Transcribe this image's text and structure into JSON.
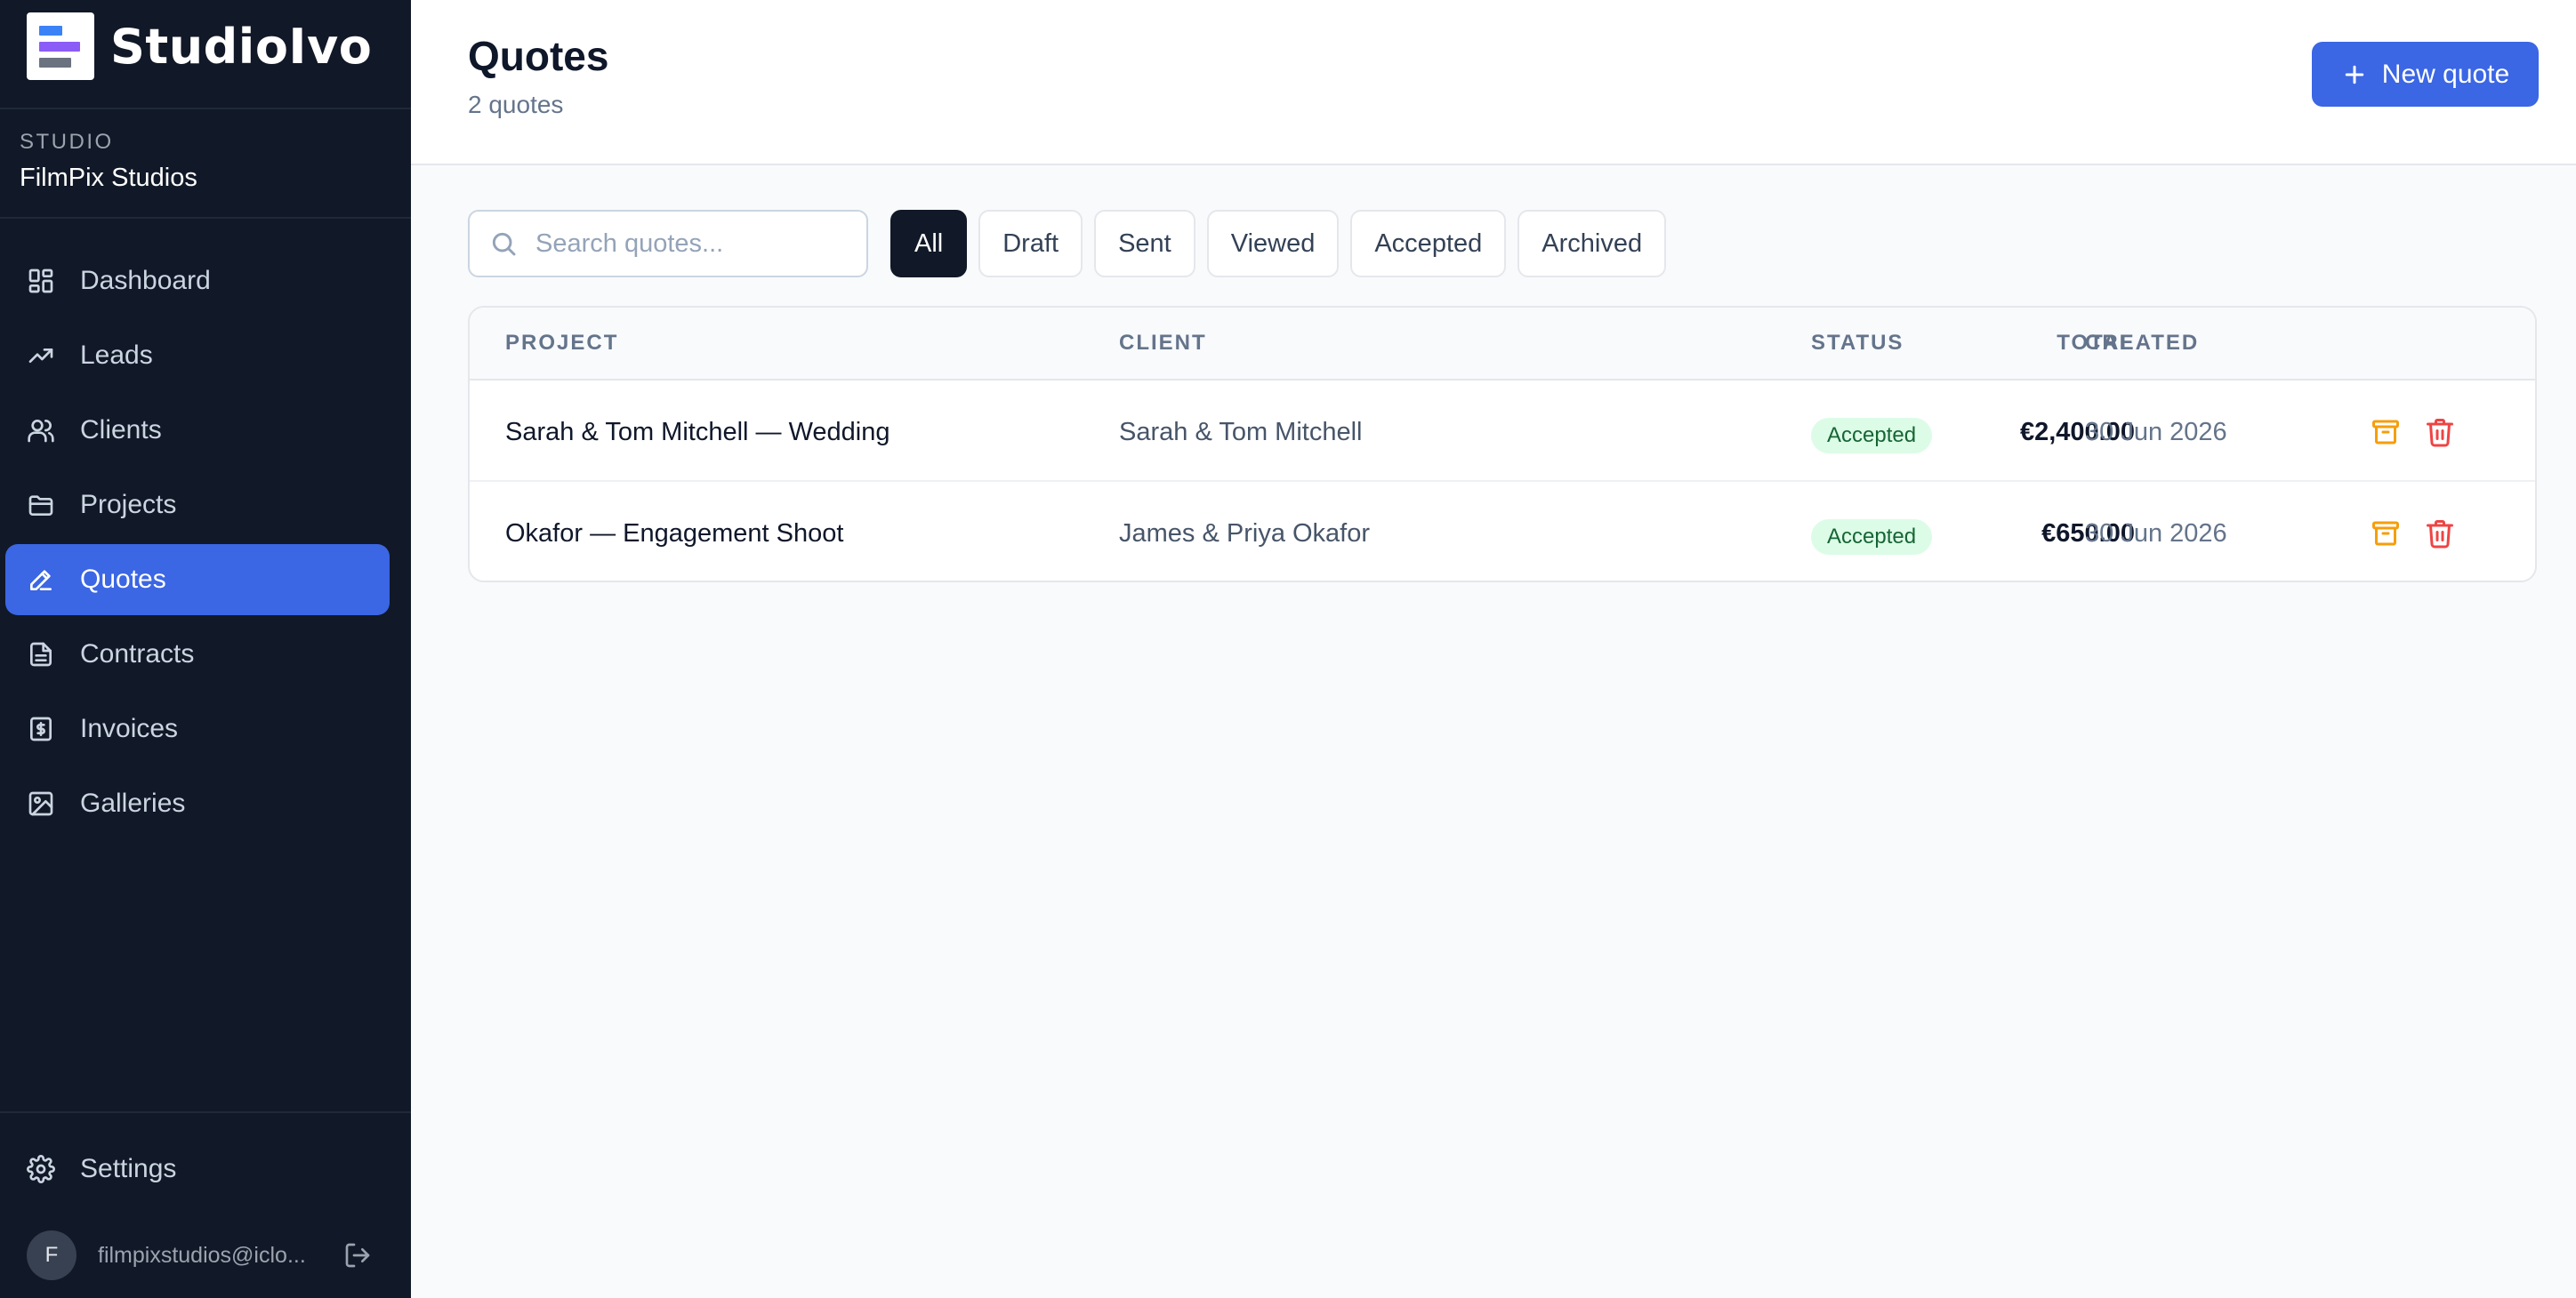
{
  "brand": {
    "name": "StudioIvo"
  },
  "studio": {
    "label": "STUDIO",
    "name": "FilmPix Studios"
  },
  "nav": {
    "items": [
      {
        "label": "Dashboard",
        "icon": "dashboard-icon"
      },
      {
        "label": "Leads",
        "icon": "trending-up-icon"
      },
      {
        "label": "Clients",
        "icon": "users-icon"
      },
      {
        "label": "Projects",
        "icon": "folder-icon"
      },
      {
        "label": "Quotes",
        "icon": "pencil-icon",
        "active": true
      },
      {
        "label": "Contracts",
        "icon": "document-icon"
      },
      {
        "label": "Invoices",
        "icon": "invoice-dollar-icon"
      },
      {
        "label": "Galleries",
        "icon": "image-icon"
      }
    ],
    "settings_label": "Settings"
  },
  "user": {
    "initial": "F",
    "email": "filmpixstudios@iclo..."
  },
  "header": {
    "title": "Quotes",
    "subtitle": "2 quotes",
    "new_button": "New quote"
  },
  "search": {
    "placeholder": "Search quotes...",
    "value": ""
  },
  "filters": [
    "All",
    "Draft",
    "Sent",
    "Viewed",
    "Accepted",
    "Archived"
  ],
  "active_filter": "All",
  "table": {
    "columns": {
      "project": "PROJECT",
      "client": "CLIENT",
      "total": "TOTAL",
      "status": "STATUS",
      "created": "CREATED"
    },
    "rows": [
      {
        "project": "Sarah & Tom Mitchell — Wedding",
        "client": "Sarah & Tom Mitchell",
        "total": "€2,400.00",
        "status": "Accepted",
        "created": "30 Jun 2026"
      },
      {
        "project": "Okafor — Engagement Shoot",
        "client": "James & Priya Okafor",
        "total": "€650.00",
        "status": "Accepted",
        "created": "30 Jun 2026"
      }
    ]
  },
  "colors": {
    "accent": "#3b66e4",
    "sidebar": "#111827",
    "status_accepted_bg": "#dcfce7",
    "status_accepted_text": "#166534",
    "archive": "#f59e0b",
    "delete": "#ef4444"
  }
}
